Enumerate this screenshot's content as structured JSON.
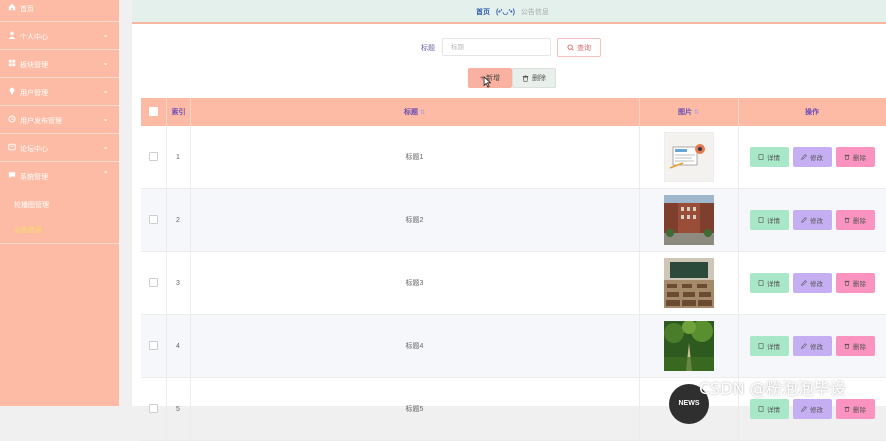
{
  "sidebar": {
    "items": [
      {
        "label": "首页",
        "icon": "home-icon"
      },
      {
        "label": "个人中心",
        "icon": "user-icon"
      },
      {
        "label": "板块管理",
        "icon": "grid-icon"
      },
      {
        "label": "用户管理",
        "icon": "bulb-icon"
      },
      {
        "label": "用户发布管理",
        "icon": "clock-icon"
      },
      {
        "label": "论坛中心",
        "icon": "forum-icon"
      },
      {
        "label": "系统管理",
        "icon": "chat-icon"
      }
    ],
    "subitems": [
      "轮播图管理",
      "公告信息"
    ]
  },
  "breadcrumb": {
    "home": "首页",
    "face": "(•'◡'•)",
    "current": "公告信息"
  },
  "search": {
    "label": "标题",
    "placeholder": "标题",
    "query_button": "查询"
  },
  "actions": {
    "add": "新增",
    "delete": "删除"
  },
  "table": {
    "headers": {
      "index": "索引",
      "title": "标题",
      "image": "图片",
      "ops": "操作"
    },
    "rows": [
      {
        "index": "1",
        "title": "标题1"
      },
      {
        "index": "2",
        "title": "标题2"
      },
      {
        "index": "3",
        "title": "标题3"
      },
      {
        "index": "4",
        "title": "标题4"
      },
      {
        "index": "5",
        "title": "标题5"
      }
    ],
    "op_labels": {
      "detail": "详情",
      "edit": "修改",
      "delete": "删除"
    }
  },
  "watermark": "CSDN @粉泡泡毕设",
  "news_badge": "NEWS",
  "colors": {
    "sidebar": "#fdbba5",
    "header_text": "#6b4fb8",
    "detail": "#a8e7c7",
    "edit": "#c6aef2",
    "delete": "#fb93c1",
    "topbar": "#e3f0ec"
  }
}
